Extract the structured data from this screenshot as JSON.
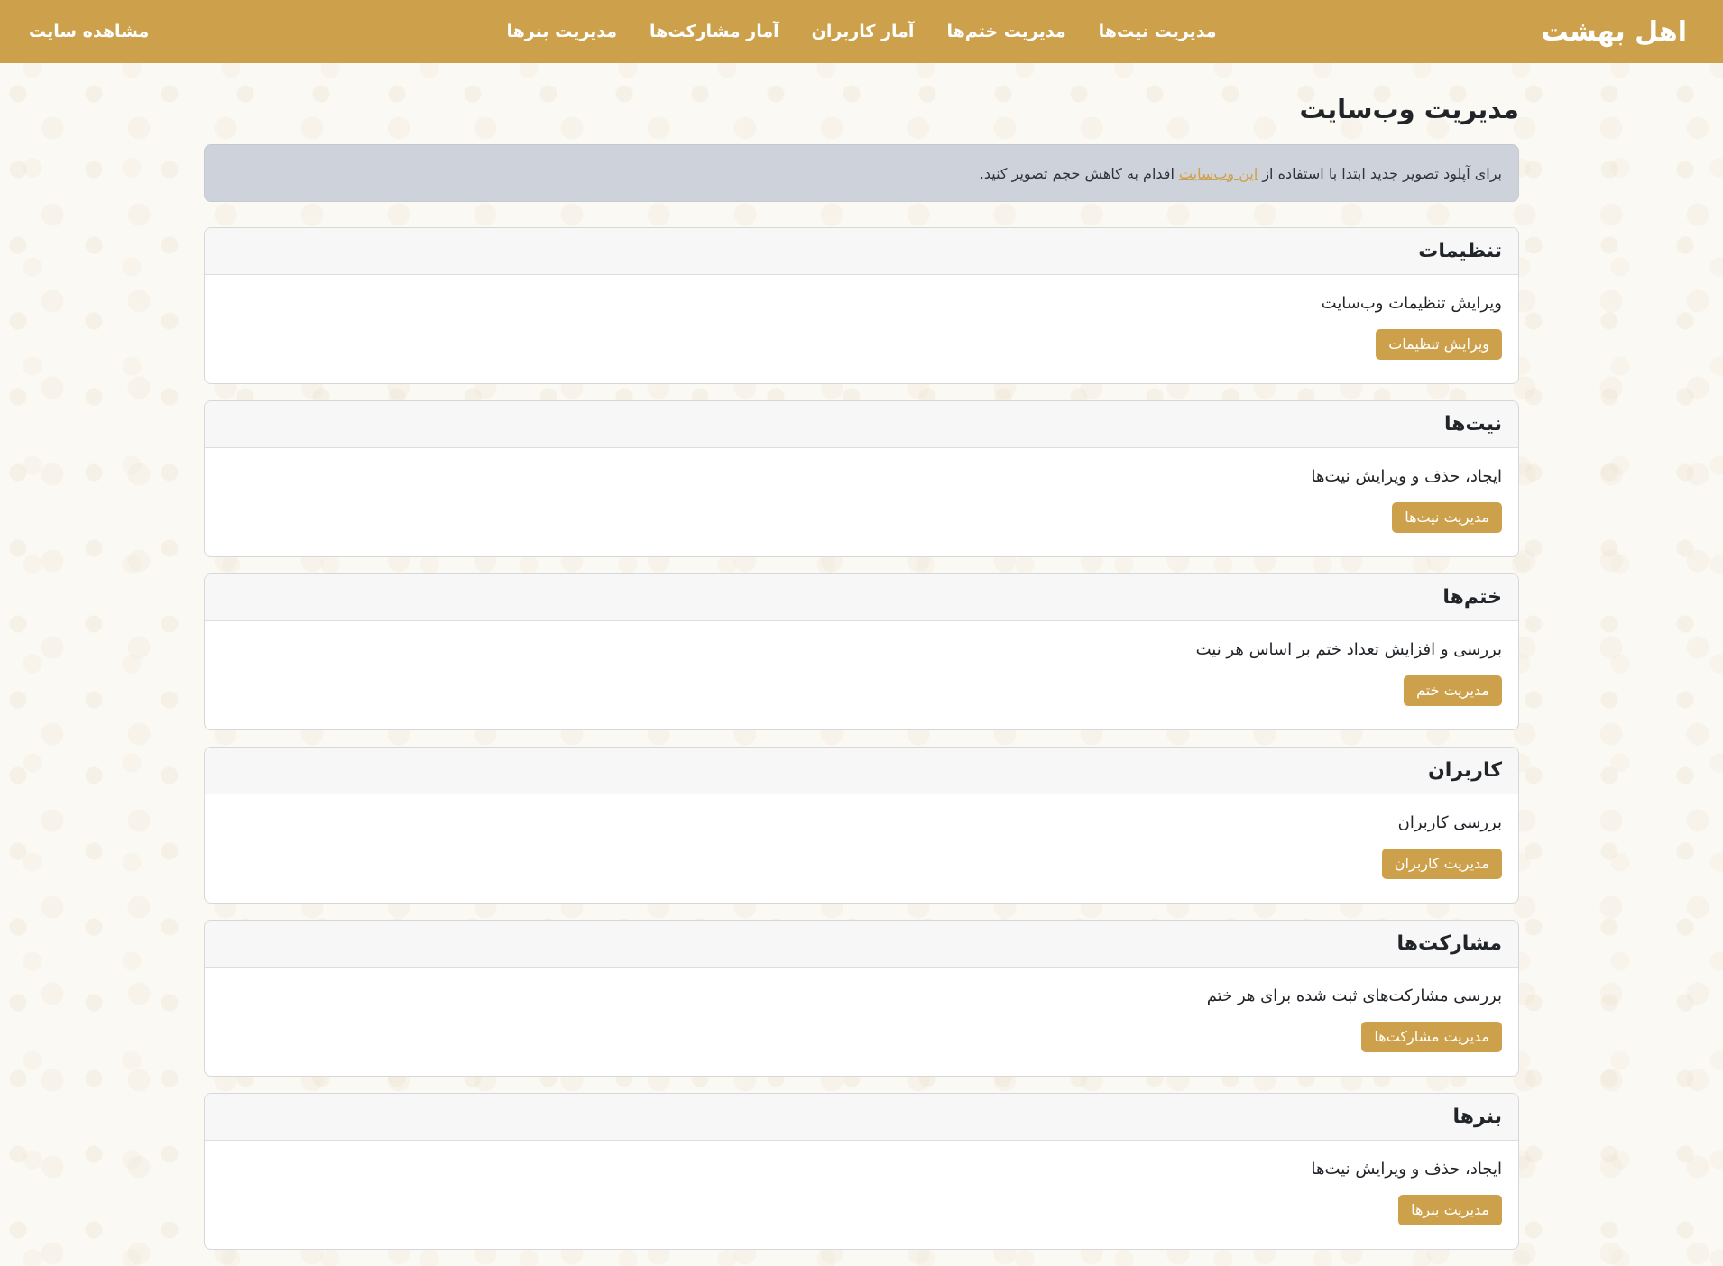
{
  "navbar": {
    "brand": "اهل بهشت",
    "links": [
      "مدیریت نیت‌ها",
      "مدیریت ختم‌ها",
      "آمار کاربران",
      "آمار مشارکت‌ها",
      "مدیریت بنرها"
    ],
    "site_link": "مشاهده سایت"
  },
  "main": {
    "title": "مدیریت وب‌سایت",
    "alert": {
      "before": "برای آپلود تصویر جدید ابتدا با استفاده از",
      "link": "این وب‌سایت",
      "after": "اقدام به کاهش حجم تصویر کنید."
    },
    "cards": [
      {
        "title": "تنظیمات",
        "text": "ویرایش تنظیمات وب‌سایت",
        "button": "ویرایش تنظیمات"
      },
      {
        "title": "نیت‌ها",
        "text": "ایجاد، حذف و ویرایش نیت‌ها",
        "button": "مدیریت نیت‌ها"
      },
      {
        "title": "ختم‌ها",
        "text": "بررسی و افزایش تعداد ختم بر اساس هر نیت",
        "button": "مدیریت ختم"
      },
      {
        "title": "کاربران",
        "text": "بررسی کاربران",
        "button": "مدیریت کاربران"
      },
      {
        "title": "مشارکت‌ها",
        "text": "بررسی مشارکت‌های ثبت شده برای هر ختم",
        "button": "مدیریت مشارکت‌ها"
      },
      {
        "title": "بنرها",
        "text": "ایجاد، حذف و ویرایش نیت‌ها",
        "button": "مدیریت بنرها"
      }
    ]
  },
  "colors": {
    "primary": "#cda14c",
    "alert_bg": "#ced2da"
  }
}
